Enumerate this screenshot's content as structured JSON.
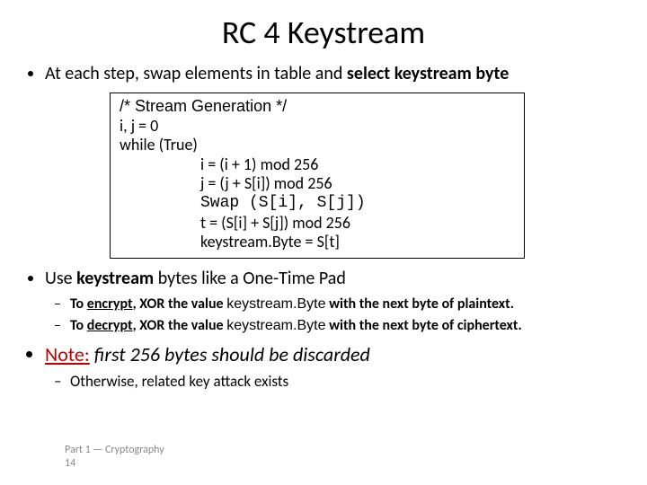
{
  "title": "RC 4 Keystream",
  "bullets": {
    "b1_pre": "At each step, swap elements in table and ",
    "b1_bold": "select keystream byte",
    "b2_pre": "Use ",
    "b2_bold": "keystream",
    "b2_post": " bytes like a One-Time Pad",
    "b2_sub1_pre": "To ",
    "b2_sub1_u": "encrypt",
    "b2_sub1_mid": ", XOR the value ",
    "b2_sub1_kb": "keystream.Byte",
    "b2_sub1_post": "  with the next byte of plaintext.",
    "b2_sub2_pre": "To ",
    "b2_sub2_u": "decrypt",
    "b2_sub2_mid": ", XOR the value ",
    "b2_sub2_kb": "keystream.Byte",
    "b2_sub2_post": "  with the next byte of ciphertext.",
    "b3_note": "Note:",
    "b3_rest": " first 256 bytes should be discarded",
    "b3_sub1": "Otherwise, related key attack exists"
  },
  "code": {
    "l1": "/* Stream Generation */",
    "l2": "i, j = 0",
    "l3": "while (True)",
    "l4": "i = (i + 1) mod 256",
    "l5": "j = (j + S[i]) mod 256",
    "l6": "Swap (S[i], S[j])",
    "l7": "t = (S[i] + S[j]) mod 256",
    "l8": "keystream.Byte = S[t]"
  },
  "footer": {
    "line1": "Part 1 — Cryptography",
    "line2": "14"
  }
}
